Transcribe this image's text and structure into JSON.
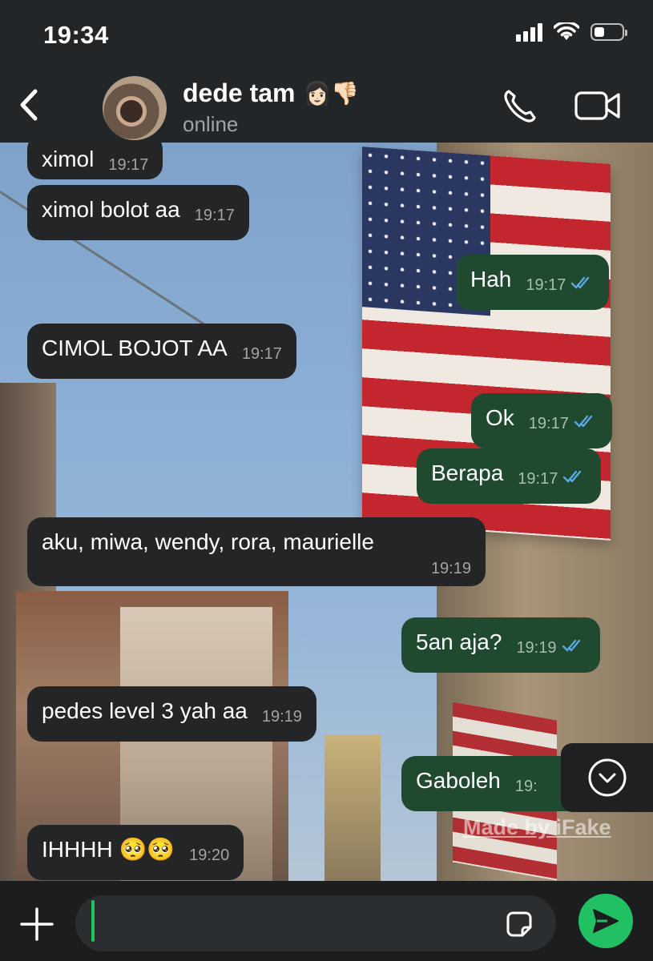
{
  "status_bar": {
    "time": "19:34"
  },
  "header": {
    "contact_name": "dede tam",
    "contact_emoji": "👩🏻👎🏻",
    "status": "online"
  },
  "messages": [
    {
      "dir": "in",
      "text": "ximol",
      "time": "19:17"
    },
    {
      "dir": "in",
      "text": "ximol bolot aa",
      "time": "19:17"
    },
    {
      "dir": "out",
      "text": "Hah",
      "time": "19:17",
      "read": true
    },
    {
      "dir": "in",
      "text": "CIMOL BOJOT AA",
      "time": "19:17"
    },
    {
      "dir": "out",
      "text": "Ok",
      "time": "19:17",
      "read": true
    },
    {
      "dir": "out",
      "text": "Berapa",
      "time": "19:17",
      "read": true
    },
    {
      "dir": "in",
      "text": "aku, miwa, wendy, rora, maurielle",
      "time": "19:19"
    },
    {
      "dir": "out",
      "text": "5an aja?",
      "time": "19:19",
      "read": true
    },
    {
      "dir": "in",
      "text": "pedes level 3 yah aa",
      "time": "19:19"
    },
    {
      "dir": "out",
      "text": "Gaboleh",
      "time": "19:",
      "read": true
    },
    {
      "dir": "in",
      "text": "IHHHH 🥺🥺",
      "time": "19:20"
    }
  ],
  "watermark": "Made by iFake",
  "icons": {
    "back": "chevron-left-icon",
    "call": "phone-icon",
    "video": "video-camera-icon",
    "scroll_down": "chevron-down-circle-icon",
    "attach": "plus-icon",
    "sticker": "sticker-icon",
    "send": "send-icon"
  },
  "colors": {
    "outgoing_bubble": "#1f4a2f",
    "incoming_bubble": "#232527",
    "accent_green": "#21c063",
    "read_ticks": "#5aa9e6"
  }
}
